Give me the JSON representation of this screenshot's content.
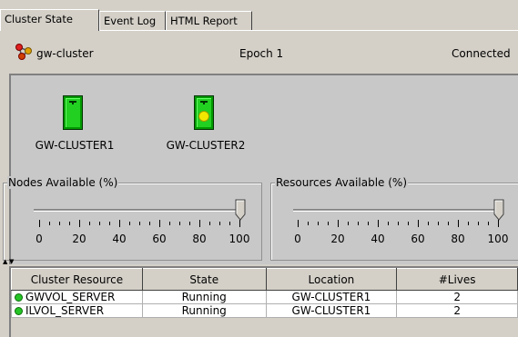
{
  "tabs": [
    {
      "label": "Cluster State",
      "active": true
    },
    {
      "label": "Event Log",
      "active": false
    },
    {
      "label": "HTML Report",
      "active": false
    }
  ],
  "header": {
    "cluster_name": "gw-cluster",
    "epoch": "Epoch 1",
    "status": "Connected"
  },
  "nodes": [
    {
      "label": "GW-CLUSTER1",
      "state_icon": "node-door-icon",
      "indicator": false
    },
    {
      "label": "GW-CLUSTER2",
      "state_icon": "node-door-icon",
      "indicator": true
    }
  ],
  "sliders": {
    "nodes": {
      "title": "Nodes Available (%)",
      "value": 100,
      "ticks": [
        "0",
        "20",
        "40",
        "60",
        "80",
        "100"
      ]
    },
    "resources": {
      "title": "Resources Available (%)",
      "value": 100,
      "ticks": [
        "0",
        "20",
        "40",
        "60",
        "80",
        "100"
      ]
    }
  },
  "table": {
    "columns": [
      "Cluster Resource",
      "State",
      "Location",
      "#Lives"
    ],
    "rows": [
      [
        "GWVOL_SERVER",
        "Running",
        "GW-CLUSTER1",
        "2"
      ],
      [
        "ILVOL_SERVER",
        "Running",
        "GW-CLUSTER1",
        "2"
      ]
    ]
  },
  "colors": {
    "node_green": "#22d022",
    "indicator_yellow": "#f5e800",
    "status_dot": "#26c426",
    "panel_bg": "#c8c8c8"
  }
}
